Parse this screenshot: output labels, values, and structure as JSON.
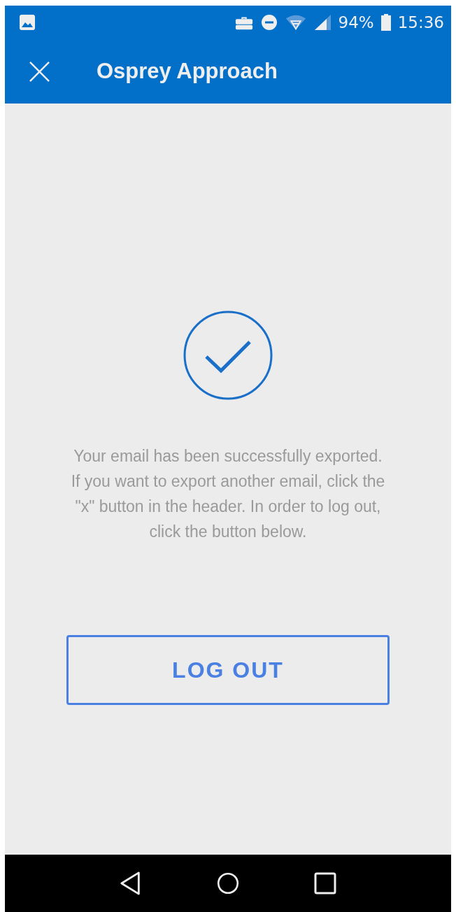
{
  "status_bar": {
    "battery": "94%",
    "time": "15:36"
  },
  "header": {
    "title": "Osprey Approach"
  },
  "message": "Your email has been successfully exported. If you want to export another email, click the \"x\" button in the header. In order to log out, click the button below.",
  "button": {
    "label": "LOG OUT"
  }
}
